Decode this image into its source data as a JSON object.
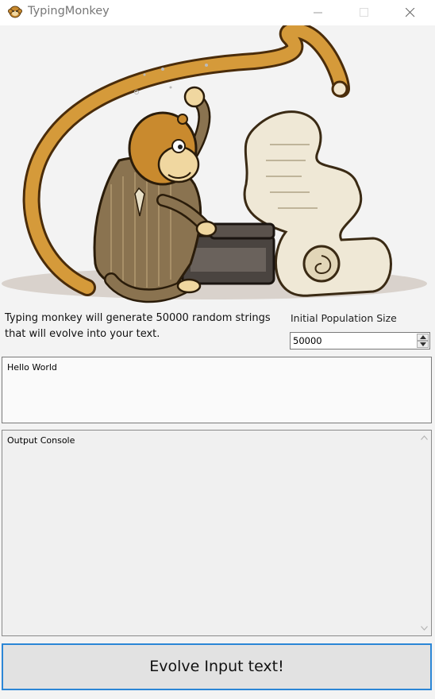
{
  "window": {
    "title": "TypingMonkey",
    "icon": "monkey-icon"
  },
  "description": {
    "line1": "Typing monkey will generate 50000 random strings",
    "line2": "that will evolve into your text."
  },
  "population": {
    "label": "Initial Population Size",
    "value": "50000"
  },
  "input": {
    "value": "Hello World"
  },
  "output": {
    "text": "Output Console"
  },
  "evolve_button": {
    "label": "Evolve Input text!"
  },
  "colors": {
    "accent": "#2b86d6",
    "monkey_fur": "#c98a2e",
    "suit": "#8a7350"
  }
}
